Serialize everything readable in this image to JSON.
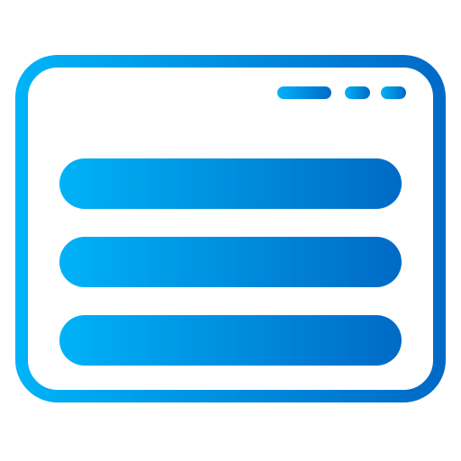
{
  "icon": {
    "name": "browser-window-list-icon",
    "gradient": {
      "start": "#00b2f7",
      "end": "#006ac6"
    }
  },
  "titlebar": {
    "controls": [
      "pill-control",
      "dot-control",
      "dot-control"
    ]
  },
  "content": {
    "rows": 3
  }
}
